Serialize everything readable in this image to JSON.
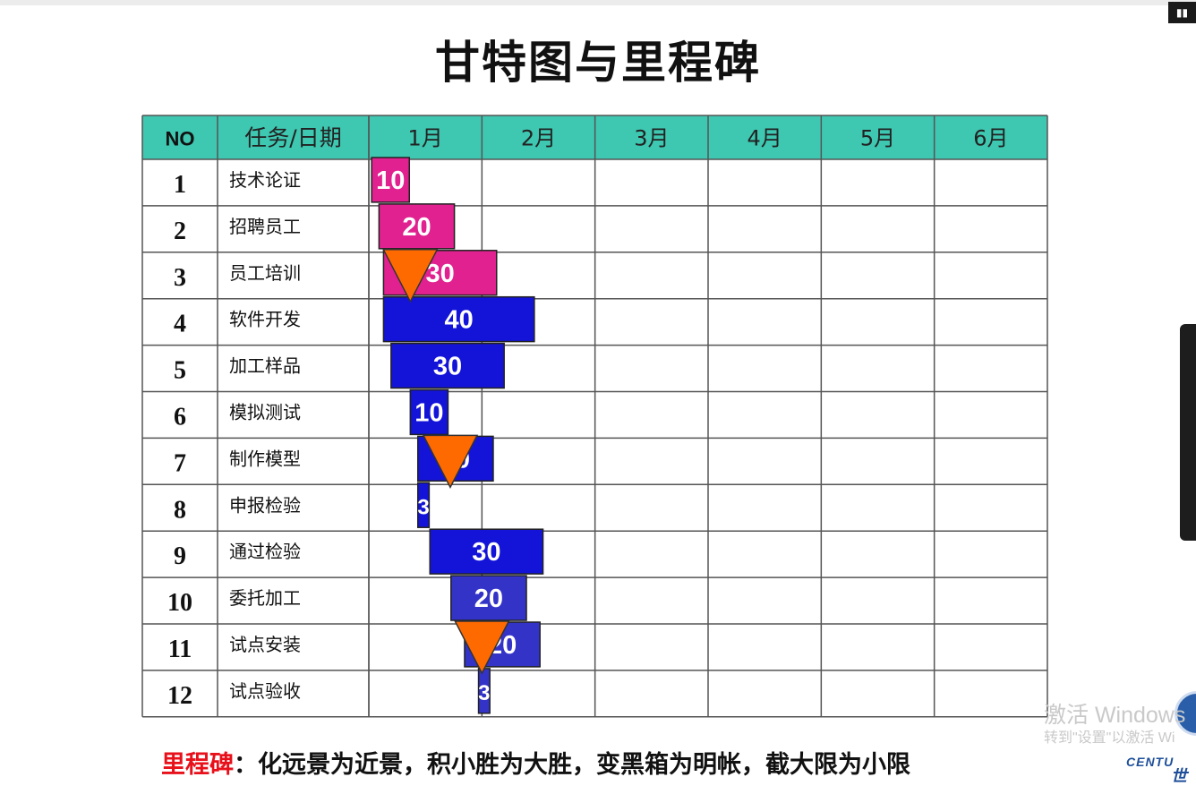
{
  "title": "甘特图与里程碑",
  "footer": {
    "key": "里程碑",
    "text": "：化远景为近景，积小胜为大胜，变黑箱为明帐，截大限为小限"
  },
  "watermark": {
    "line1": "激活 Windows",
    "line2": "转到\"设置\"以激活 Wi"
  },
  "brand": {
    "line1": "CENTU",
    "line2": "世"
  },
  "colors": {
    "header_bg": "#3ec7b1",
    "grid": "#555555",
    "phase1": "#e0218f",
    "phase2": "#1414d8",
    "phase3": "#3333c8",
    "milestone": "#ff6a00"
  },
  "chart_data": {
    "type": "gantt",
    "columns": [
      "NO",
      "任务/日期"
    ],
    "months": [
      "1月",
      "2月",
      "3月",
      "4月",
      "5月",
      "6月"
    ],
    "days_per_month": 30,
    "tasks": [
      {
        "no": "1",
        "name": "技术论证",
        "start": 0.75,
        "duration": 10,
        "color": "#e0218f"
      },
      {
        "no": "2",
        "name": "招聘员工",
        "start": 2.7,
        "duration": 20,
        "color": "#e0218f"
      },
      {
        "no": "3",
        "name": "员工培训",
        "start": 3.9,
        "duration": 30,
        "color": "#e0218f"
      },
      {
        "no": "4",
        "name": "软件开发",
        "start": 3.9,
        "duration": 40,
        "color": "#1414d8"
      },
      {
        "no": "5",
        "name": "加工样品",
        "start": 5.9,
        "duration": 30,
        "color": "#1414d8"
      },
      {
        "no": "6",
        "name": "模拟测试",
        "start": 11.0,
        "duration": 10,
        "color": "#1414d8"
      },
      {
        "no": "7",
        "name": "制作模型",
        "start": 13.0,
        "duration": 20,
        "color": "#1414d8"
      },
      {
        "no": "8",
        "name": "申报检验",
        "start": 13.0,
        "duration": 3,
        "color": "#1414d8"
      },
      {
        "no": "9",
        "name": "通过检验",
        "start": 16.2,
        "duration": 30,
        "color": "#1414d8"
      },
      {
        "no": "10",
        "name": "委托加工",
        "start": 21.8,
        "duration": 20,
        "color": "#3333c8"
      },
      {
        "no": "11",
        "name": "试点安装",
        "start": 25.4,
        "duration": 20,
        "color": "#3333c8"
      },
      {
        "no": "12",
        "name": "试点验收",
        "start": 29.1,
        "duration": 3,
        "color": "#3333c8"
      }
    ],
    "milestones": [
      {
        "after_task": "3",
        "position": 11.0
      },
      {
        "after_task": "7",
        "position": 21.6
      },
      {
        "after_task": "11",
        "position": 30.0
      }
    ]
  }
}
